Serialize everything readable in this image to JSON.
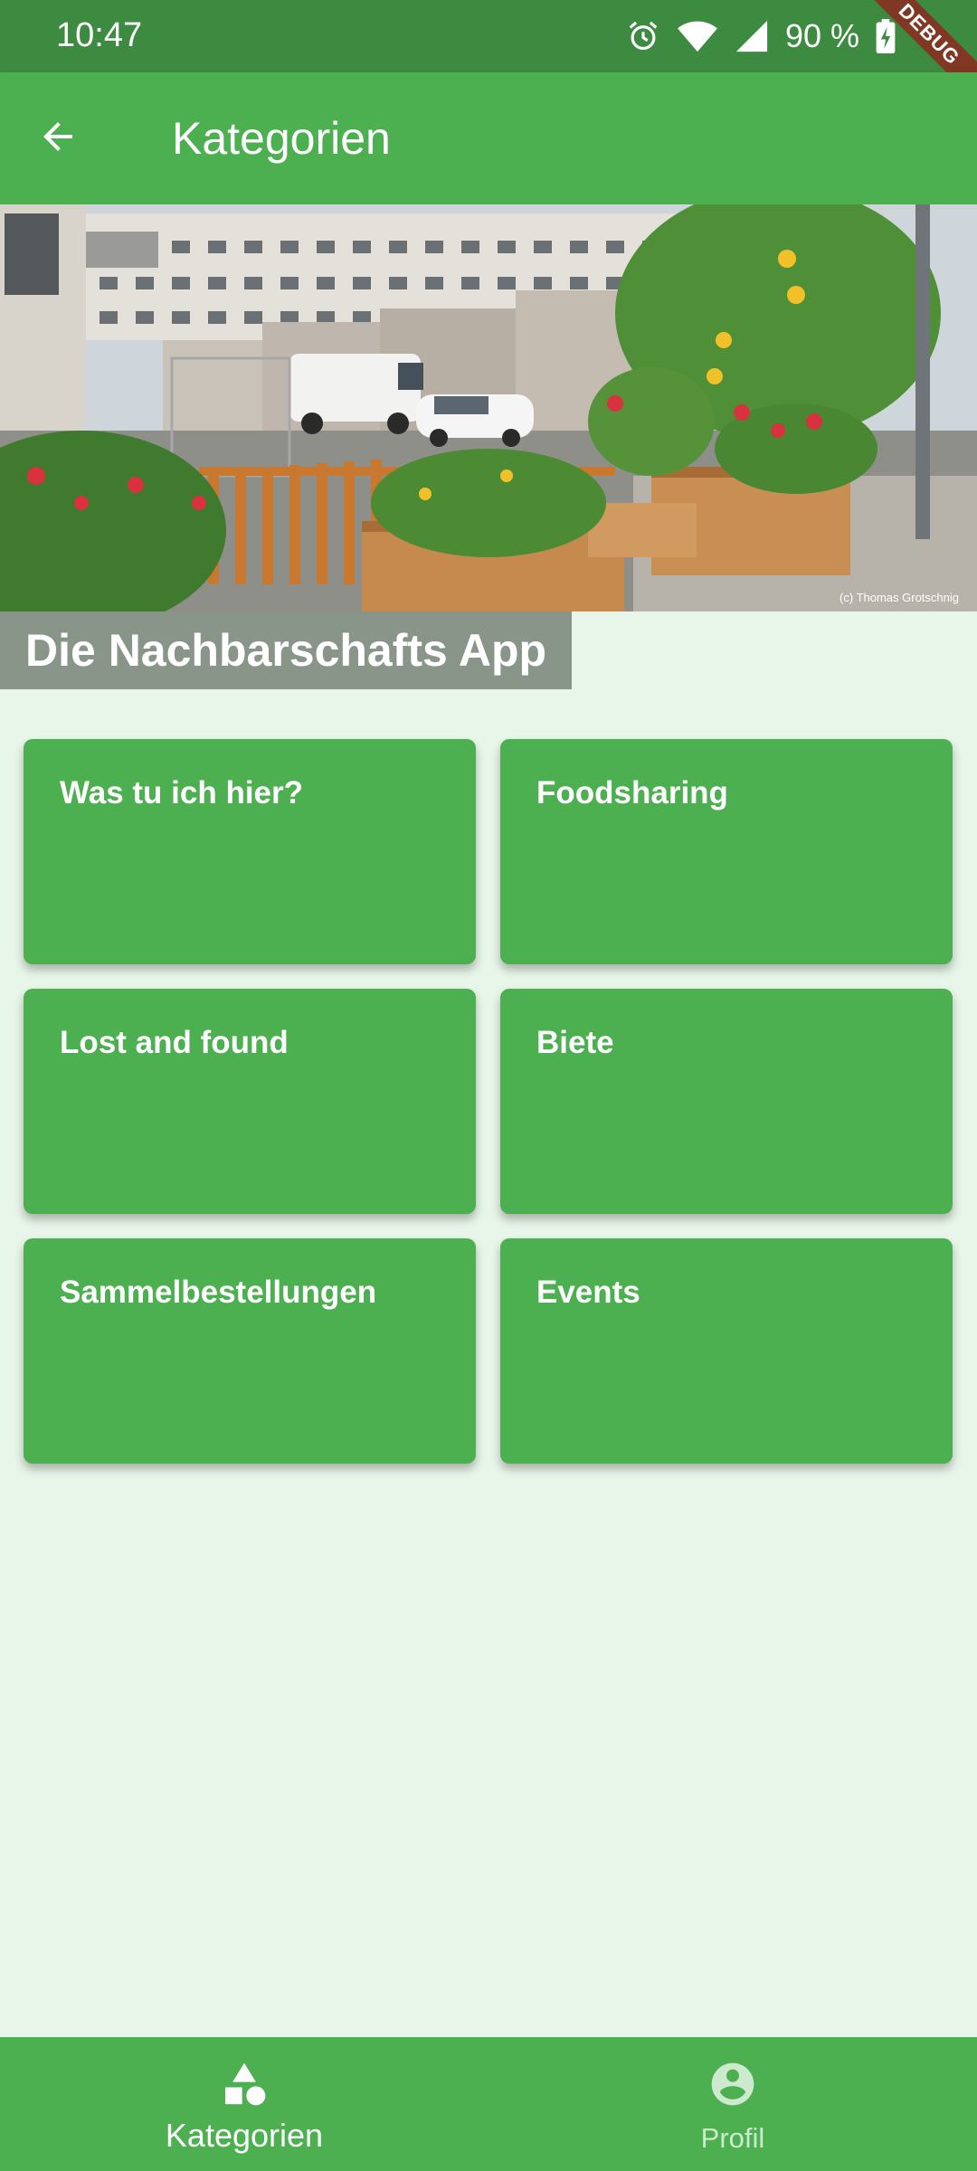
{
  "status_bar": {
    "time": "10:47",
    "battery": "90 %",
    "debug_banner": "DEBUG",
    "icons": [
      "alarm-icon",
      "wifi-icon",
      "signal-icon",
      "battery-charging-icon"
    ]
  },
  "app_bar": {
    "title": "Kategorien",
    "back_icon": "arrow-back-icon"
  },
  "hero": {
    "photo_credit": "(c) Thomas Grotschnig",
    "caption": "Die Nachbarschafts App"
  },
  "categories": [
    {
      "label": "Was tu ich hier?"
    },
    {
      "label": "Foodsharing"
    },
    {
      "label": "Lost and found"
    },
    {
      "label": "Biete"
    },
    {
      "label": "Sammelbestellungen"
    },
    {
      "label": "Events"
    }
  ],
  "bottom_nav": {
    "items": [
      {
        "label": "Kategorien",
        "icon": "category-icon",
        "active": true
      },
      {
        "label": "Profil",
        "icon": "account-circle-icon",
        "active": false
      }
    ]
  },
  "colors": {
    "primary": "#4caf50",
    "status_bar": "#3d8b40",
    "background": "#e8f5e9",
    "caption_bg": "#8a958a"
  }
}
